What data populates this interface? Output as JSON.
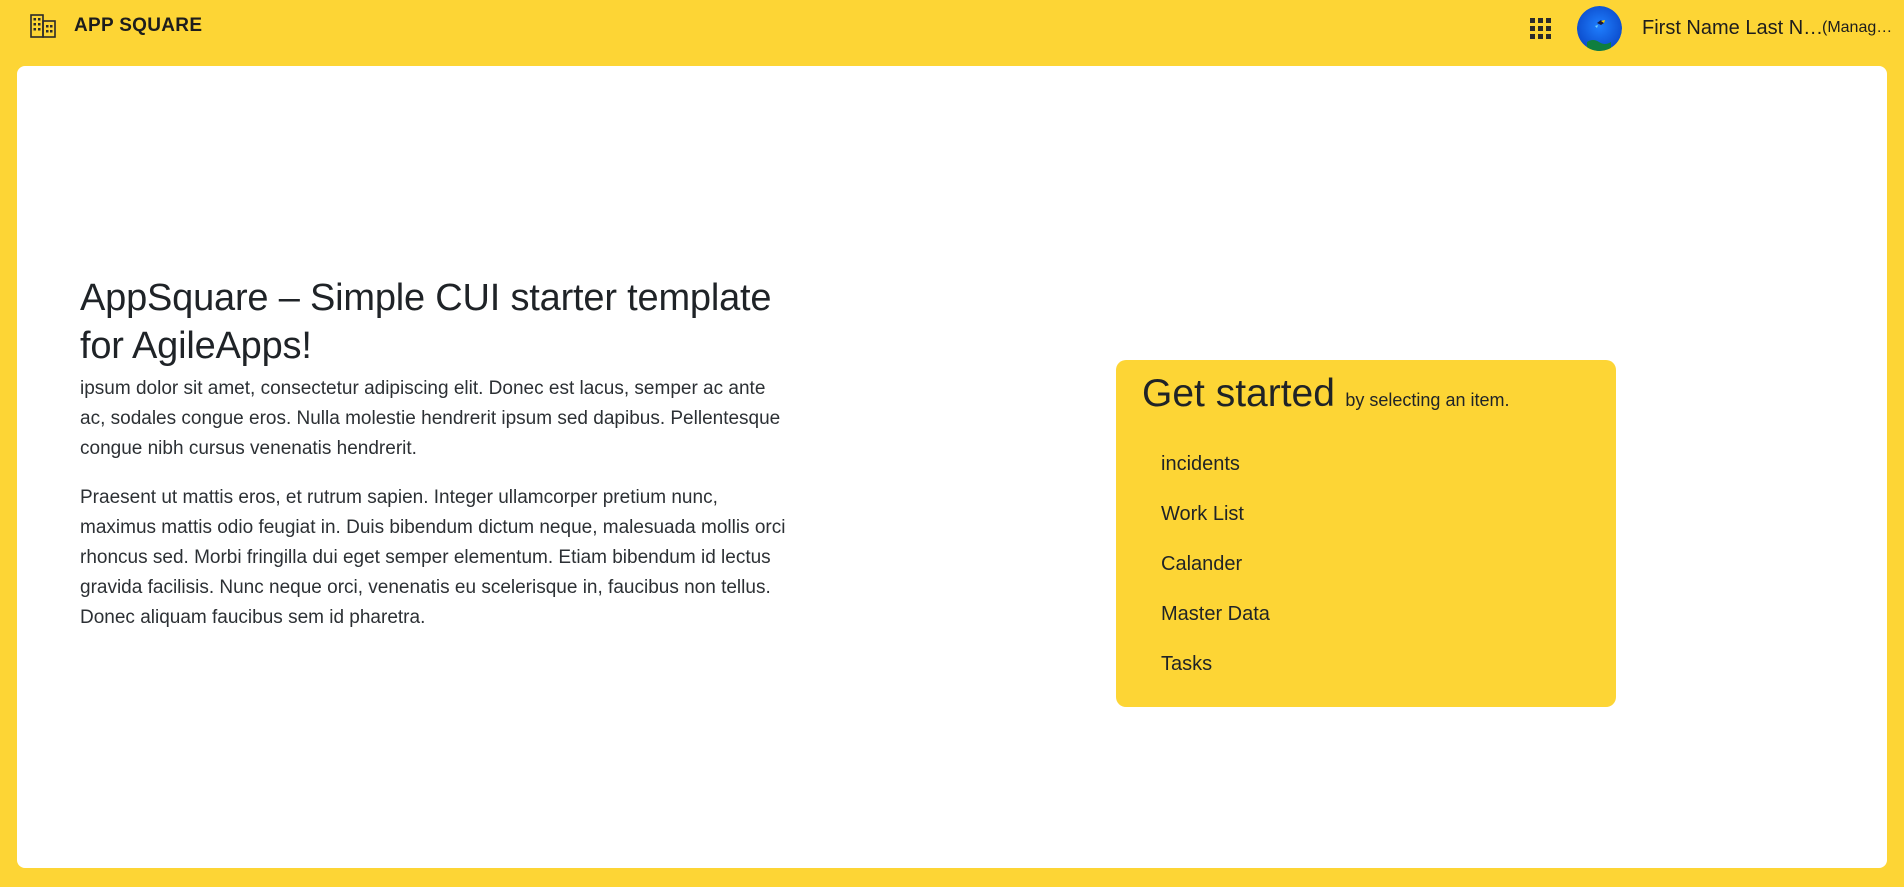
{
  "header": {
    "brand_icon": "building-icon",
    "app_title": "APP SQUARE",
    "apps_icon": "grid-apps-icon",
    "user": {
      "avatar": "user-avatar",
      "name": "First Name Last N…",
      "role": "(Manag…"
    }
  },
  "main": {
    "heading": "AppSquare – Simple CUI starter template for AgileApps!",
    "paragraphs": [
      "ipsum dolor sit amet, consectetur adipiscing elit. Donec est lacus, semper ac ante ac, sodales congue eros. Nulla molestie hendrerit ipsum sed dapibus. Pellentesque congue nibh cursus venenatis hendrerit.",
      "Praesent ut mattis eros, et rutrum sapien. Integer ullamcorper pretium nunc, maximus mattis odio feugiat in. Duis bibendum dictum neque, malesuada mollis orci rhoncus sed. Morbi fringilla dui eget semper elementum. Etiam bibendum id lectus gravida facilisis. Nunc neque orci, venenatis eu scelerisque in, faucibus non tellus. Donec aliquam faucibus sem id pharetra."
    ]
  },
  "get_started": {
    "title": "Get started",
    "subtitle": "by selecting an item.",
    "items": [
      {
        "label": "incidents"
      },
      {
        "label": "Work List"
      },
      {
        "label": "Calander"
      },
      {
        "label": "Master Data"
      },
      {
        "label": "Tasks"
      }
    ]
  },
  "colors": {
    "brand_yellow": "#fdd535",
    "card_background": "#ffffff",
    "text_dark": "#1f2327"
  }
}
